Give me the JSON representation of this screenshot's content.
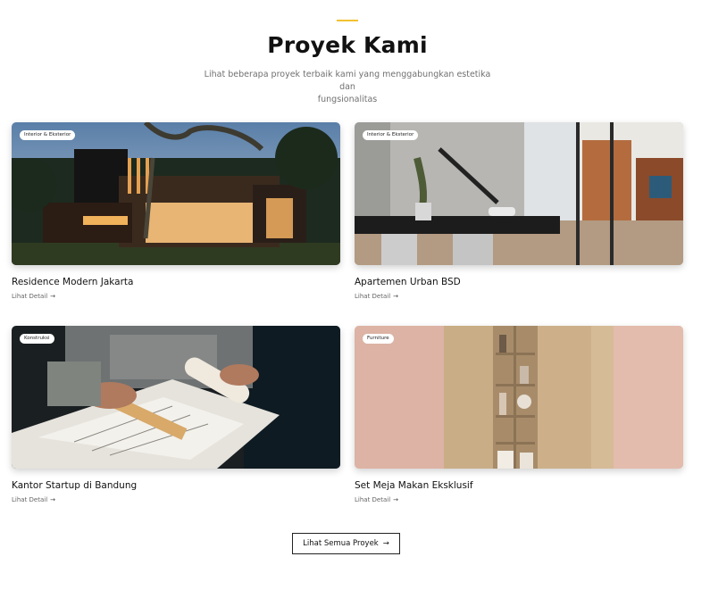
{
  "header": {
    "title": "Proyek Kami",
    "subtitle_line1": "Lihat beberapa proyek terbaik kami yang menggabungkan estetika dan",
    "subtitle_line2": "fungsionalitas",
    "accent_color": "#f2c230"
  },
  "projects": [
    {
      "badge": "Interior & Eksterior",
      "title": "Residence Modern Jakarta",
      "link_label": "Lihat Detail",
      "link_icon": "arrow-right-icon"
    },
    {
      "badge": "Interior & Eksterior",
      "title": "Apartemen Urban BSD",
      "link_label": "Lihat Detail",
      "link_icon": "arrow-right-icon"
    },
    {
      "badge": "Konstruksi",
      "title": "Kantor Startup di Bandung",
      "link_label": "Lihat Detail",
      "link_icon": "arrow-right-icon"
    },
    {
      "badge": "Furniture",
      "title": "Set Meja Makan Eksklusif",
      "link_label": "Lihat Detail",
      "link_icon": "arrow-right-icon"
    }
  ],
  "cta": {
    "label": "Lihat Semua Proyek",
    "icon": "arrow-right-icon"
  }
}
